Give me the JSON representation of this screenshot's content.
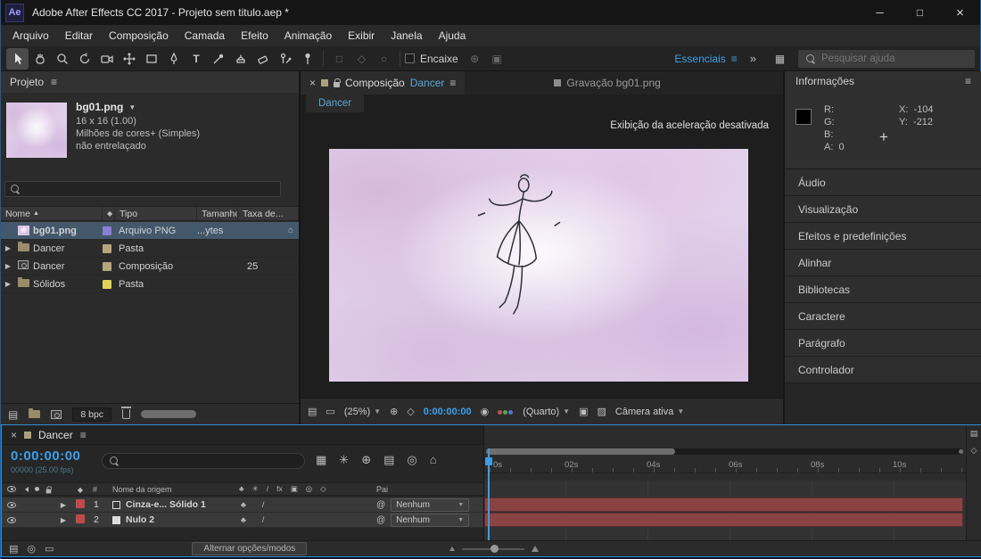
{
  "window": {
    "app_badge": "Ae",
    "title": "Adobe After Effects CC 2017 - Projeto sem titulo.aep *"
  },
  "icons": {
    "menu": "≡",
    "close": "×",
    "minimize": "─",
    "maximize": "□",
    "chevron_down": "▼",
    "sort_asc": "▲",
    "twirl": "▶",
    "overflow": "»",
    "pickwhip": "@",
    "slash": "/",
    "club": "♣",
    "asterisk": "✳",
    "fx": "fx",
    "hash": "#",
    "crosshair": "+",
    "tag": "◆",
    "flowchart": "▤",
    "monitor": "▭",
    "grid": "▦",
    "target": "⊕",
    "mask": "◇",
    "camera": "◉",
    "roi": "▣",
    "transparency": "▨",
    "house": "⌂",
    "rings": "◎"
  },
  "menu": {
    "items": [
      "Arquivo",
      "Editar",
      "Composição",
      "Camada",
      "Efeito",
      "Animação",
      "Exibir",
      "Janela",
      "Ajuda"
    ]
  },
  "toolbar": {
    "snap_label": "Encaixe",
    "workspace_label": "Essenciais",
    "search_placeholder": "Pesquisar ajuda"
  },
  "project_panel": {
    "title": "Projeto",
    "preview": {
      "name": "bg01.png",
      "dimensions": "16 x 16 (1.00)",
      "colors": "Milhões de cores+ (Simples)",
      "interlace": "não entrelaçado"
    },
    "columns": {
      "name": "Nome",
      "type": "Tipo",
      "size": "Tamanho",
      "rate": "Taxa de..."
    },
    "rows": [
      {
        "name": "bg01.png",
        "type": "Arquivo PNG",
        "size": "...ytes",
        "rate": "",
        "label_color": "#8a7fd4",
        "selected": true
      },
      {
        "name": "Dancer",
        "type": "Pasta",
        "size": "",
        "rate": "",
        "label_color": "#b5a57d",
        "selected": false
      },
      {
        "name": "Dancer",
        "type": "Composição",
        "size": "",
        "rate": "25",
        "label_color": "#b5a57d",
        "selected": false
      },
      {
        "name": "Sólidos",
        "type": "Pasta",
        "size": "",
        "rate": "",
        "label_color": "#ddd35a",
        "selected": false
      }
    ],
    "bpc_label": "8 bpc"
  },
  "comp_panel": {
    "tab1_panel": "Composição",
    "tab1_name": "Dancer",
    "tab2": "Gravação bg01.png",
    "viewer_tab": "Dancer",
    "notice": "Exibição da aceleração desativada",
    "zoom": "(25%)",
    "timecode": "0:00:00:00",
    "resolution": "(Quarto)",
    "view_layout": "Câmera ativa"
  },
  "info_panel": {
    "title": "Informações",
    "r": "R:",
    "g": "G:",
    "b": "B:",
    "a": "A:",
    "a_value": "0",
    "x": "X:",
    "x_value": "-104",
    "y": "Y:",
    "y_value": "-212"
  },
  "side_panels": [
    "Áudio",
    "Visualização",
    "Efeitos e predefinições",
    "Alinhar",
    "Bibliotecas",
    "Caractere",
    "Parágrafo",
    "Controlador"
  ],
  "timeline": {
    "tab": "Dancer",
    "timecode": "0:00:00:00",
    "frame_info": "00000 (25.00 fps)",
    "columns": {
      "source": "Nome da origem",
      "parent": "Pai"
    },
    "layers": [
      {
        "num": "1",
        "name": "Cinza-e... Sólido 1",
        "parent": "Nenhum",
        "label_color": "#c04a4a"
      },
      {
        "num": "2",
        "name": "Nulo 2",
        "parent": "Nenhum",
        "label_color": "#c04a4a"
      }
    ],
    "ruler_ticks": [
      "0s",
      "02s",
      "04s",
      "06s",
      "08s",
      "10s"
    ],
    "modes_button": "Alternar opções/modos"
  },
  "colors": {
    "accent_blue": "#3f9fe0",
    "timecode_blue": "#3ba0ec",
    "selection_row": "#44586c",
    "layer_bar_red": "#8a4343",
    "cache_green": "#5aa43c",
    "canvas_lavender": "#e3d4ec"
  }
}
